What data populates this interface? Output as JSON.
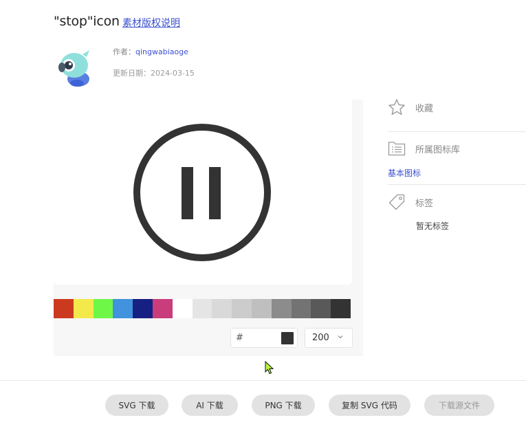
{
  "header": {
    "title": "\"stop\"icon",
    "copyright_link": "素材版权说明"
  },
  "meta": {
    "author_label": "作者：",
    "author_name": "qingwabiaoge",
    "date_label": "更新日期：",
    "date_value": "2024-03-15"
  },
  "palette": [
    "#cb3a1f",
    "#f4e94b",
    "#6ff748",
    "#4193dd",
    "#161f82",
    "#c93d7c",
    "#ffffff",
    "#e5e5e5",
    "#d9d9d9",
    "#cccccc",
    "#bfbfbf",
    "#8c8c8c",
    "#737373",
    "#595959",
    "#333333"
  ],
  "color_input": {
    "hash": "#",
    "value": "",
    "current_color": "#333333"
  },
  "size_select": {
    "value": "200"
  },
  "sidebar": {
    "favorite_label": "收藏",
    "library_label": "所属图标库",
    "library_link": "基本图标",
    "tags_label": "标签",
    "tags_empty": "暂无标签"
  },
  "actions": {
    "svg_download": "SVG 下载",
    "ai_download": "AI 下载",
    "png_download": "PNG 下载",
    "copy_svg": "复制 SVG 代码",
    "source_download": "下载源文件"
  },
  "icons": {
    "preview": "pause-circle-icon",
    "favorite": "star-outline-icon",
    "library": "folder-list-icon",
    "tag": "tag-icon",
    "chevron": "chevron-down-icon",
    "avatar": "mascot-avatar"
  },
  "colors": {
    "accent_link": "#3a4fd0",
    "icon_fill": "#333333"
  }
}
